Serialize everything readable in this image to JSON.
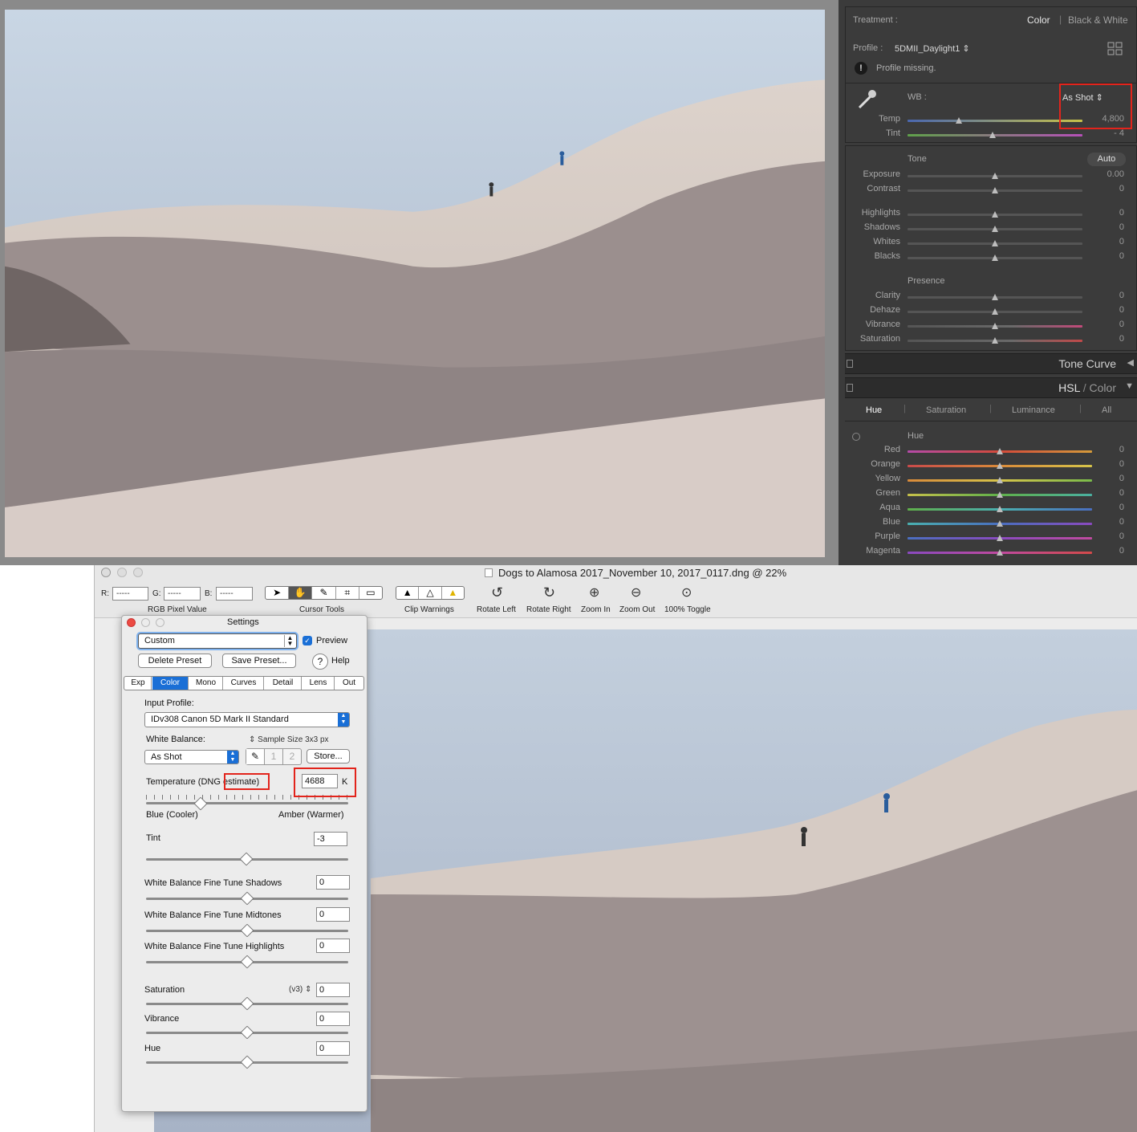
{
  "lightroom": {
    "treatment": {
      "label": "Treatment :",
      "options": [
        "Color",
        "Black & White"
      ]
    },
    "profile": {
      "label": "Profile :",
      "value": "5DMII_Daylight1 ⇕",
      "warning": "Profile missing."
    },
    "wb": {
      "label": "WB :",
      "value": "As Shot ⇕"
    },
    "temp": {
      "label": "Temp",
      "value": "4,800",
      "position": 0.29
    },
    "tint": {
      "label": "Tint",
      "value": "- 4",
      "position": 0.49
    },
    "tone": {
      "title": "Tone",
      "auto": "Auto"
    },
    "tone_sliders": [
      {
        "label": "Exposure",
        "value": "0.00"
      },
      {
        "label": "Contrast",
        "value": "0"
      },
      {
        "label": "Highlights",
        "value": "0"
      },
      {
        "label": "Shadows",
        "value": "0"
      },
      {
        "label": "Whites",
        "value": "0"
      },
      {
        "label": "Blacks",
        "value": "0"
      }
    ],
    "presence": {
      "title": "Presence"
    },
    "presence_sliders": [
      {
        "label": "Clarity",
        "value": "0"
      },
      {
        "label": "Dehaze",
        "value": "0"
      },
      {
        "label": "Vibrance",
        "value": "0"
      },
      {
        "label": "Saturation",
        "value": "0"
      }
    ],
    "tone_curve": "Tone Curve",
    "hsl": {
      "hsl": "HSL",
      "sep": " / ",
      "color": "Color"
    },
    "hsl_tabs": [
      "Hue",
      "Saturation",
      "Luminance",
      "All"
    ],
    "hue_title": "Hue",
    "hue_sliders": [
      {
        "label": "Red",
        "value": "0"
      },
      {
        "label": "Orange",
        "value": "0"
      },
      {
        "label": "Yellow",
        "value": "0"
      },
      {
        "label": "Green",
        "value": "0"
      },
      {
        "label": "Aqua",
        "value": "0"
      },
      {
        "label": "Blue",
        "value": "0"
      },
      {
        "label": "Purple",
        "value": "0"
      },
      {
        "label": "Magenta",
        "value": "0"
      }
    ]
  },
  "window": {
    "title": "Dogs to Alamosa 2017_November 10, 2017_0117.dng @ 22%",
    "rgb": {
      "r_label": "R:",
      "g_label": "G:",
      "b_label": "B:",
      "placeholder": "-----",
      "caption": "RGB Pixel Value"
    },
    "cursor_tools_caption": "Cursor Tools",
    "clip_caption": "Clip Warnings",
    "tools": [
      {
        "label": "Rotate Left"
      },
      {
        "label": "Rotate Right"
      },
      {
        "label": "Zoom In"
      },
      {
        "label": "Zoom Out"
      },
      {
        "label": "100% Toggle"
      }
    ]
  },
  "settings": {
    "title": "Settings",
    "preset": "Custom",
    "preview_label": "Preview",
    "delete_preset": "Delete Preset",
    "save_preset": "Save Preset...",
    "help": "Help",
    "tabs": [
      "Exp",
      "Color",
      "Mono",
      "Curves",
      "Detail",
      "Lens",
      "Out"
    ],
    "active_tab": "Color",
    "input_profile_label": "Input Profile:",
    "input_profile": "IDv308 Canon 5D Mark II Standard",
    "wb_label": "White Balance:",
    "sample_size": "⇕ Sample Size 3x3 px",
    "wb_value": "As Shot",
    "slot1": "1",
    "slot2": "2",
    "store": "Store...",
    "temp_label": "Temperature (DNG estimate)",
    "temp_value": "4688",
    "temp_unit": "K",
    "temp_position": 0.24,
    "cooler": "Blue (Cooler)",
    "warmer": "Amber (Warmer)",
    "tint_label": "Tint",
    "tint_value": "-3",
    "fine_tune": [
      {
        "label": "White Balance Fine Tune Shadows",
        "value": "0"
      },
      {
        "label": "White Balance Fine Tune Midtones",
        "value": "0"
      },
      {
        "label": "White Balance Fine Tune Highlights",
        "value": "0"
      }
    ],
    "saturation_label": "Saturation",
    "saturation_version": "(v3) ⇕",
    "saturation_value": "0",
    "vibrance_label": "Vibrance",
    "vibrance_value": "0",
    "hue_label": "Hue",
    "hue_value": "0"
  },
  "colors": {
    "accent": "#1a6fd6",
    "highlight_box": "#e2241c",
    "lr_bg": "#3b3b3b"
  }
}
